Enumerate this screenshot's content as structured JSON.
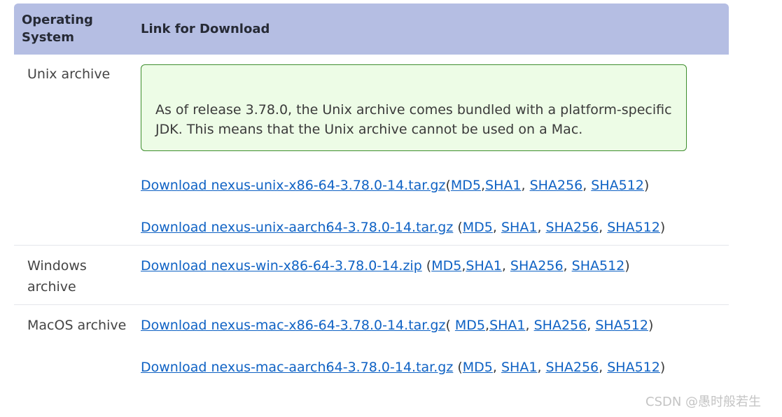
{
  "header": {
    "col_os": "Operating System",
    "col_link": "Link for Download"
  },
  "rows": [
    {
      "os": "Unix archive",
      "note": "As of release 3.78.0, the Unix archive comes bundled with a platform-specific JDK. This means that the Unix archive cannot be used on a Mac.",
      "downloads": [
        {
          "label": "Download nexus-unix-x86-64-3.78.0-14.tar.gz",
          "sep_open": "(",
          "md5": "MD5",
          "sha1": "SHA1",
          "sha256": "SHA256",
          "sha512": "SHA512",
          "sep_close": ")"
        },
        {
          "label": "Download nexus-unix-aarch64-3.78.0-14.tar.gz",
          "sep_open": " (",
          "md5": "MD5",
          "sha1": "SHA1",
          "sha256": "SHA256",
          "sha512": "SHA512",
          "sep_close": ")"
        }
      ]
    },
    {
      "os": "Windows archive",
      "downloads": [
        {
          "label": "Download nexus-win-x86-64-3.78.0-14.zip",
          "sep_open": " (",
          "md5": "MD5",
          "sha1": "SHA1",
          "sha256": "SHA256",
          "sha512": "SHA512",
          "sep_close": ")"
        }
      ]
    },
    {
      "os": "MacOS archive",
      "downloads": [
        {
          "label": "Download nexus-mac-x86-64-3.78.0-14.tar.gz",
          "sep_open": "( ",
          "md5": "MD5",
          "sha1": "SHA1",
          "sha256": "SHA256",
          "sha512": "SHA512",
          "sep_close": ")"
        },
        {
          "label": "Download nexus-mac-aarch64-3.78.0-14.tar.gz",
          "sep_open": " (",
          "md5": "MD5",
          "sha1": "SHA1",
          "sha256": "SHA256",
          "sha512": "SHA512",
          "sep_close": ")"
        }
      ]
    }
  ],
  "watermark": "CSDN @愚时般若生",
  "colors": {
    "header_bg": "#b5bee3",
    "link": "#0f62c4",
    "note_bg": "#edfce6",
    "note_border": "#3e8e2e"
  }
}
